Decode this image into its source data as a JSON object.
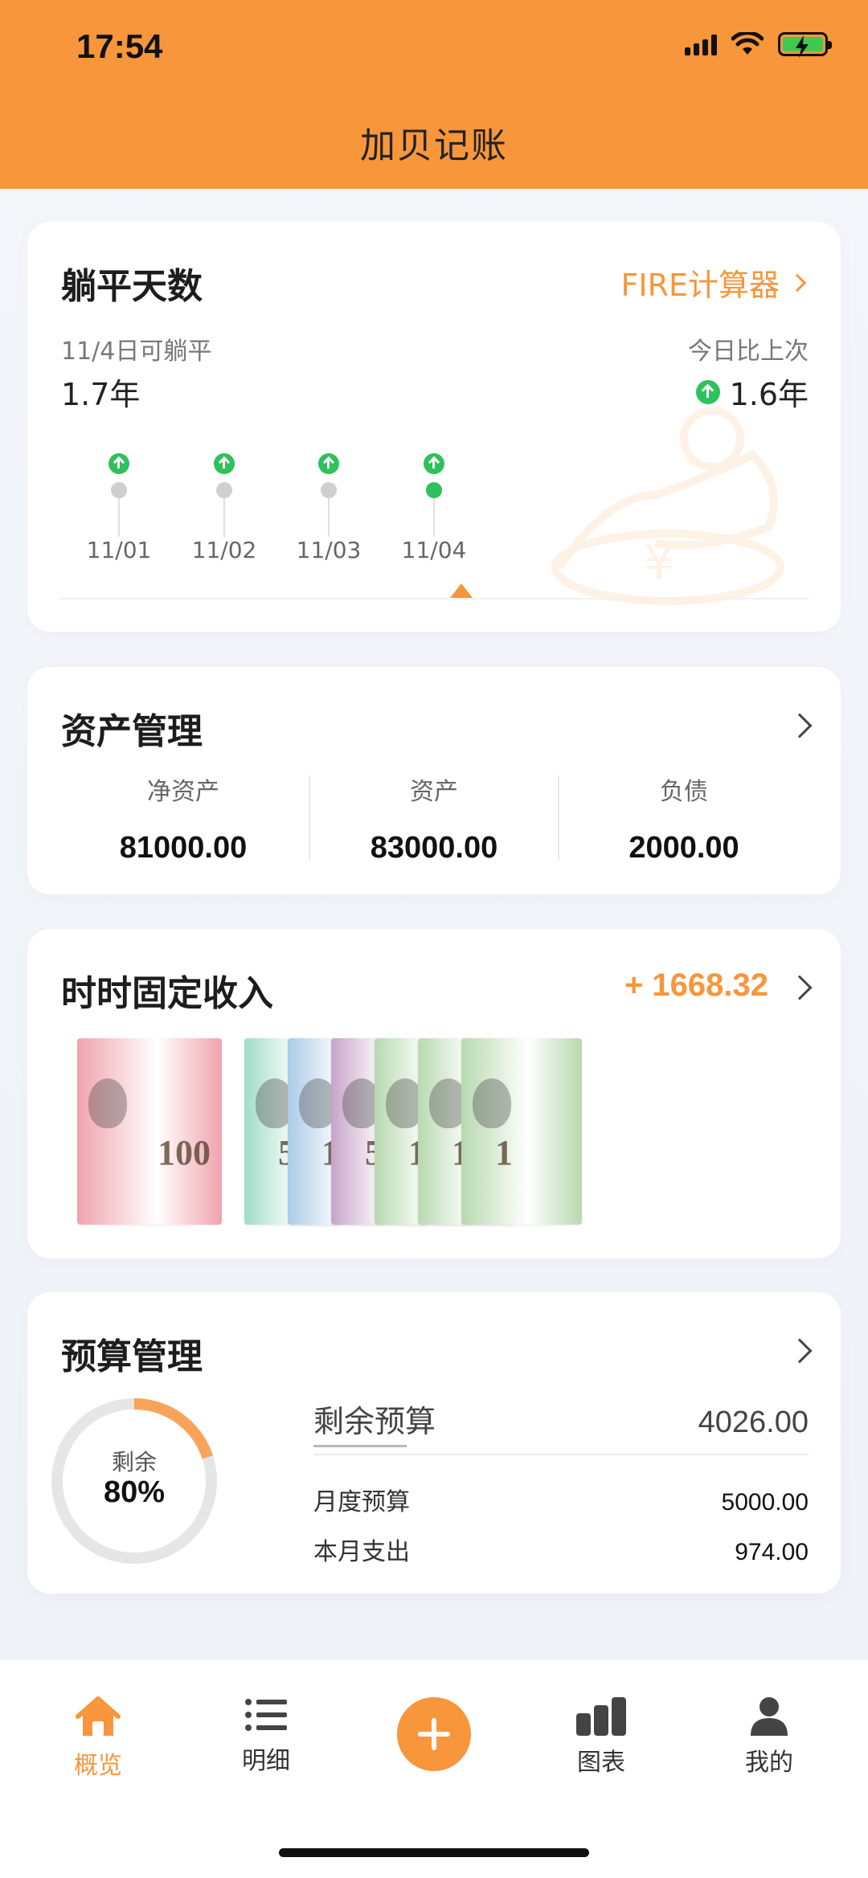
{
  "status_bar": {
    "time": "17:54"
  },
  "header": {
    "title": "加贝记账"
  },
  "fire_card": {
    "title": "躺平天数",
    "link_label": "FIRE计算器",
    "date_label": "11/4日可躺平",
    "years": "1.7年",
    "compare_label": "今日比上次",
    "compare_value": "1.6年",
    "timeline": [
      {
        "date": "11/01",
        "active": false
      },
      {
        "date": "11/02",
        "active": false
      },
      {
        "date": "11/03",
        "active": false
      },
      {
        "date": "11/04",
        "active": true
      }
    ]
  },
  "assets_card": {
    "title": "资产管理",
    "net_label": "净资产",
    "net_value": "81000.00",
    "assets_label": "资产",
    "assets_value": "83000.00",
    "debt_label": "负债",
    "debt_value": "2000.00"
  },
  "income_card": {
    "title": "时时固定收入",
    "value": "+ 1668.32",
    "notes": [
      {
        "denom": "100",
        "color": "#f0a3ad"
      },
      {
        "denom": "50",
        "color": "#9fdcc8"
      },
      {
        "denom": "10",
        "color": "#a9cbe8"
      },
      {
        "denom": "5",
        "color": "#c7a3c9"
      },
      {
        "denom": "1",
        "color": "#b8d9b0"
      },
      {
        "denom": "1",
        "color": "#b8d9b0"
      },
      {
        "denom": "1",
        "color": "#b8d9b0"
      }
    ]
  },
  "budget_card": {
    "title": "预算管理",
    "ring_label": "剩余",
    "ring_value": "80%",
    "remaining_fraction": 0.8,
    "remaining_label": "剩余预算",
    "remaining_value": "4026.00",
    "monthly_label": "月度预算",
    "monthly_value": "5000.00",
    "spent_label": "本月支出",
    "spent_value": "974.00"
  },
  "nav": {
    "overview": "概览",
    "detail": "明细",
    "charts": "图表",
    "mine": "我的"
  },
  "colors": {
    "accent": "#f7963b",
    "green": "#2fc15b"
  }
}
